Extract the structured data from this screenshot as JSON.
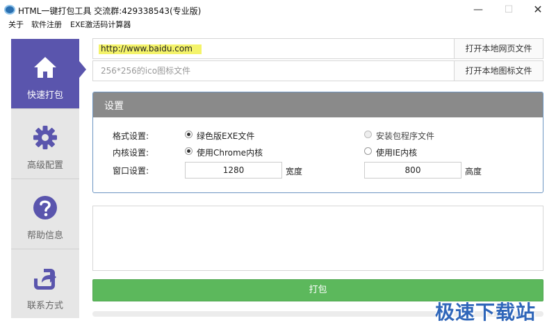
{
  "window": {
    "title": "HTML一键打包工具 交流群:429338543(专业版)",
    "minimize_glyph": "—",
    "maximize_glyph": "☐",
    "close_glyph": "✕"
  },
  "menu": {
    "items": [
      "关于",
      "软件注册",
      "EXE激活码计算器"
    ]
  },
  "sidebar": {
    "items": [
      {
        "label": "快速打包",
        "icon": "home-icon",
        "active": true
      },
      {
        "label": "高级配置",
        "icon": "gear-icon",
        "active": false
      },
      {
        "label": "帮助信息",
        "icon": "help-icon",
        "active": false
      },
      {
        "label": "联系方式",
        "icon": "share-icon",
        "active": false
      }
    ],
    "active_color": "#5a55ad"
  },
  "source": {
    "url_value": "http://www.baidu.com",
    "url_button": "打开本地网页文件",
    "icon_placeholder": "256*256的ico图标文件",
    "icon_button": "打开本地图标文件"
  },
  "settings": {
    "title": "设置",
    "format_label": "格式设置:",
    "format_option_green": "绿色版EXE文件",
    "format_option_installer": "安装包程序文件",
    "kernel_label": "内核设置:",
    "kernel_option_chrome": "使用Chrome内核",
    "kernel_option_ie": "使用IE内核",
    "window_label": "窗口设置:",
    "width_value": "1280",
    "width_unit": "宽度",
    "height_value": "800",
    "height_unit": "高度"
  },
  "actions": {
    "pack_label": "打包",
    "pack_color": "#5cb85c",
    "progress": 0
  },
  "watermark": "极速下载站"
}
